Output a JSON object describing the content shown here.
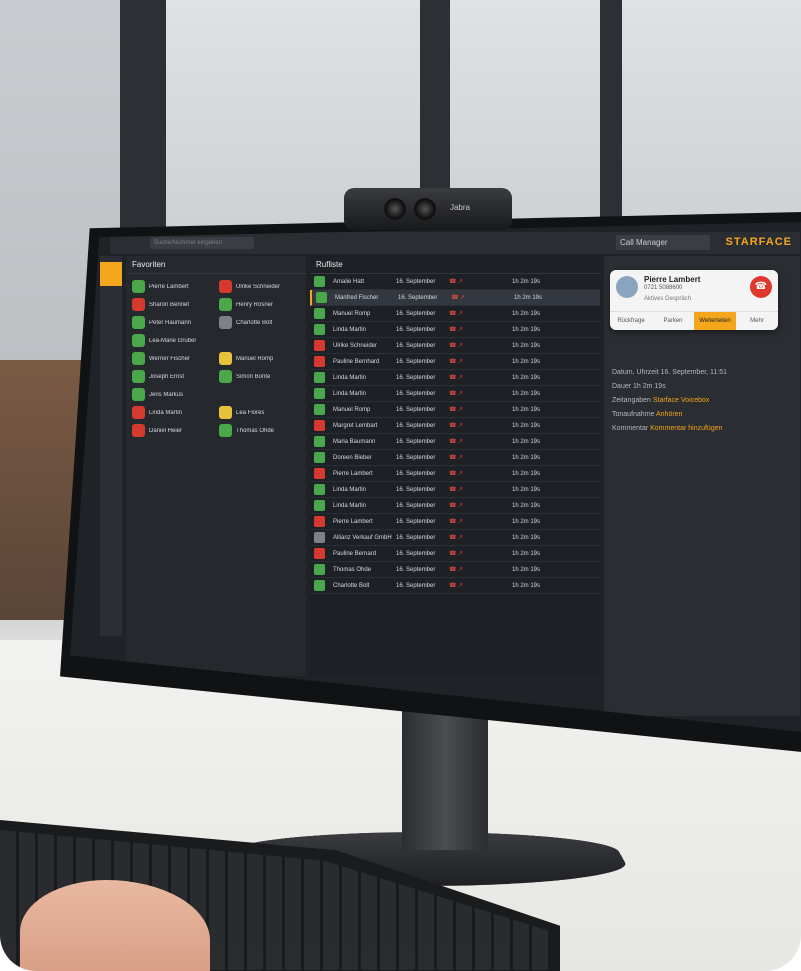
{
  "scene": {
    "webcam_brand": "Jabra"
  },
  "app": {
    "brand": "STARFACE",
    "search_placeholder": "Suche/Nummer eingeben",
    "call_manager": "Call Manager"
  },
  "favorites": {
    "title": "Favoriten",
    "items": [
      {
        "name": "Pierre Lambert",
        "color": "green"
      },
      {
        "name": "Ulrike Schneider",
        "color": "red"
      },
      {
        "name": "Sharon Bennet",
        "color": "red"
      },
      {
        "name": "Henry Rosner",
        "color": "green"
      },
      {
        "name": "Peter Haumann",
        "color": "green"
      },
      {
        "name": "Charlotte Bolt",
        "color": "gray"
      },
      {
        "name": "Lea-Marie Gruber",
        "color": "green"
      },
      {
        "name": "",
        "color": ""
      },
      {
        "name": "Werner Fischer",
        "color": "green"
      },
      {
        "name": "Manuel Romp",
        "color": "yellow"
      },
      {
        "name": "Joseph Ernst",
        "color": "green"
      },
      {
        "name": "Simon Bonte",
        "color": "green"
      },
      {
        "name": "Jens Markus",
        "color": "green"
      },
      {
        "name": "",
        "color": ""
      },
      {
        "name": "Linda Martin",
        "color": "red"
      },
      {
        "name": "Lea Flores",
        "color": "yellow"
      },
      {
        "name": "Daniel Heier",
        "color": "red"
      },
      {
        "name": "Thomas Ohde",
        "color": "green"
      }
    ]
  },
  "calls": {
    "title": "Rufliste",
    "rows": [
      {
        "name": "Amalie Hatt",
        "date": "16. September",
        "dur": "1h 2m 19s",
        "color": "green"
      },
      {
        "name": "Manfred Fischer",
        "date": "16. September",
        "dur": "1h 2m 19s",
        "color": "green",
        "selected": true
      },
      {
        "name": "Manuel Romp",
        "date": "16. September",
        "dur": "1h 2m 19s",
        "color": "green"
      },
      {
        "name": "Linda Martin",
        "date": "16. September",
        "dur": "1h 2m 19s",
        "color": "green"
      },
      {
        "name": "Ulrike Schneider",
        "date": "16. September",
        "dur": "1h 2m 19s",
        "color": "red"
      },
      {
        "name": "Pauline Bernhard",
        "date": "16. September",
        "dur": "1h 2m 19s",
        "color": "red"
      },
      {
        "name": "Linda Martin",
        "date": "16. September",
        "dur": "1h 2m 19s",
        "color": "green"
      },
      {
        "name": "Linda Martin",
        "date": "16. September",
        "dur": "1h 2m 19s",
        "color": "green"
      },
      {
        "name": "Manuel Romp",
        "date": "16. September",
        "dur": "1h 2m 19s",
        "color": "green"
      },
      {
        "name": "Margret Lembart",
        "date": "16. September",
        "dur": "1h 2m 19s",
        "color": "red"
      },
      {
        "name": "Maria Baumann",
        "date": "16. September",
        "dur": "1h 2m 19s",
        "color": "green"
      },
      {
        "name": "Doreen Bieber",
        "date": "16. September",
        "dur": "1h 2m 19s",
        "color": "green"
      },
      {
        "name": "Pierre Lambert",
        "date": "16. September",
        "dur": "1h 2m 19s",
        "color": "red"
      },
      {
        "name": "Linda Martin",
        "date": "16. September",
        "dur": "1h 2m 19s",
        "color": "green"
      },
      {
        "name": "Linda Martin",
        "date": "16. September",
        "dur": "1h 2m 19s",
        "color": "green"
      },
      {
        "name": "Pierre Lambert",
        "date": "16. September",
        "dur": "1h 2m 19s",
        "color": "red"
      },
      {
        "name": "Allianz Verkauf GmbH",
        "date": "16. September",
        "dur": "1h 2m 19s",
        "color": "gray"
      },
      {
        "name": "Pauline Bernard",
        "date": "16. September",
        "dur": "1h 2m 19s",
        "color": "red"
      },
      {
        "name": "Thomas Ohde",
        "date": "16. September",
        "dur": "1h 2m 19s",
        "color": "green"
      },
      {
        "name": "Charlotte Bolt",
        "date": "16. September",
        "dur": "1h 2m 19s",
        "color": "green"
      }
    ]
  },
  "active_call": {
    "name": "Pierre Lambert",
    "number": "0721 5088600",
    "status": "Aktives Gespräch",
    "actions": [
      "Rückfrage",
      "Parken",
      "Weiterleiten",
      "Mehr"
    ],
    "active_action_index": 2
  },
  "detail": {
    "fields": [
      {
        "label": "Datum, Uhrzeit",
        "value": "16. September, 11:51"
      },
      {
        "label": "Dauer",
        "value": "1h 2m 19s"
      },
      {
        "label": "Zeitangaben",
        "value": "Starface Voicebox",
        "link": true
      },
      {
        "label": "Tonaufnahme",
        "value": "Anhören",
        "link": true
      },
      {
        "label": "Kommentar",
        "value": "Kommentar hinzufügen",
        "link": true
      }
    ]
  },
  "colors": {
    "accent": "#f4a61d",
    "available": "#4aa84a",
    "busy": "#d63a2e",
    "away": "#e8c23a",
    "offline": "#7c8288"
  }
}
